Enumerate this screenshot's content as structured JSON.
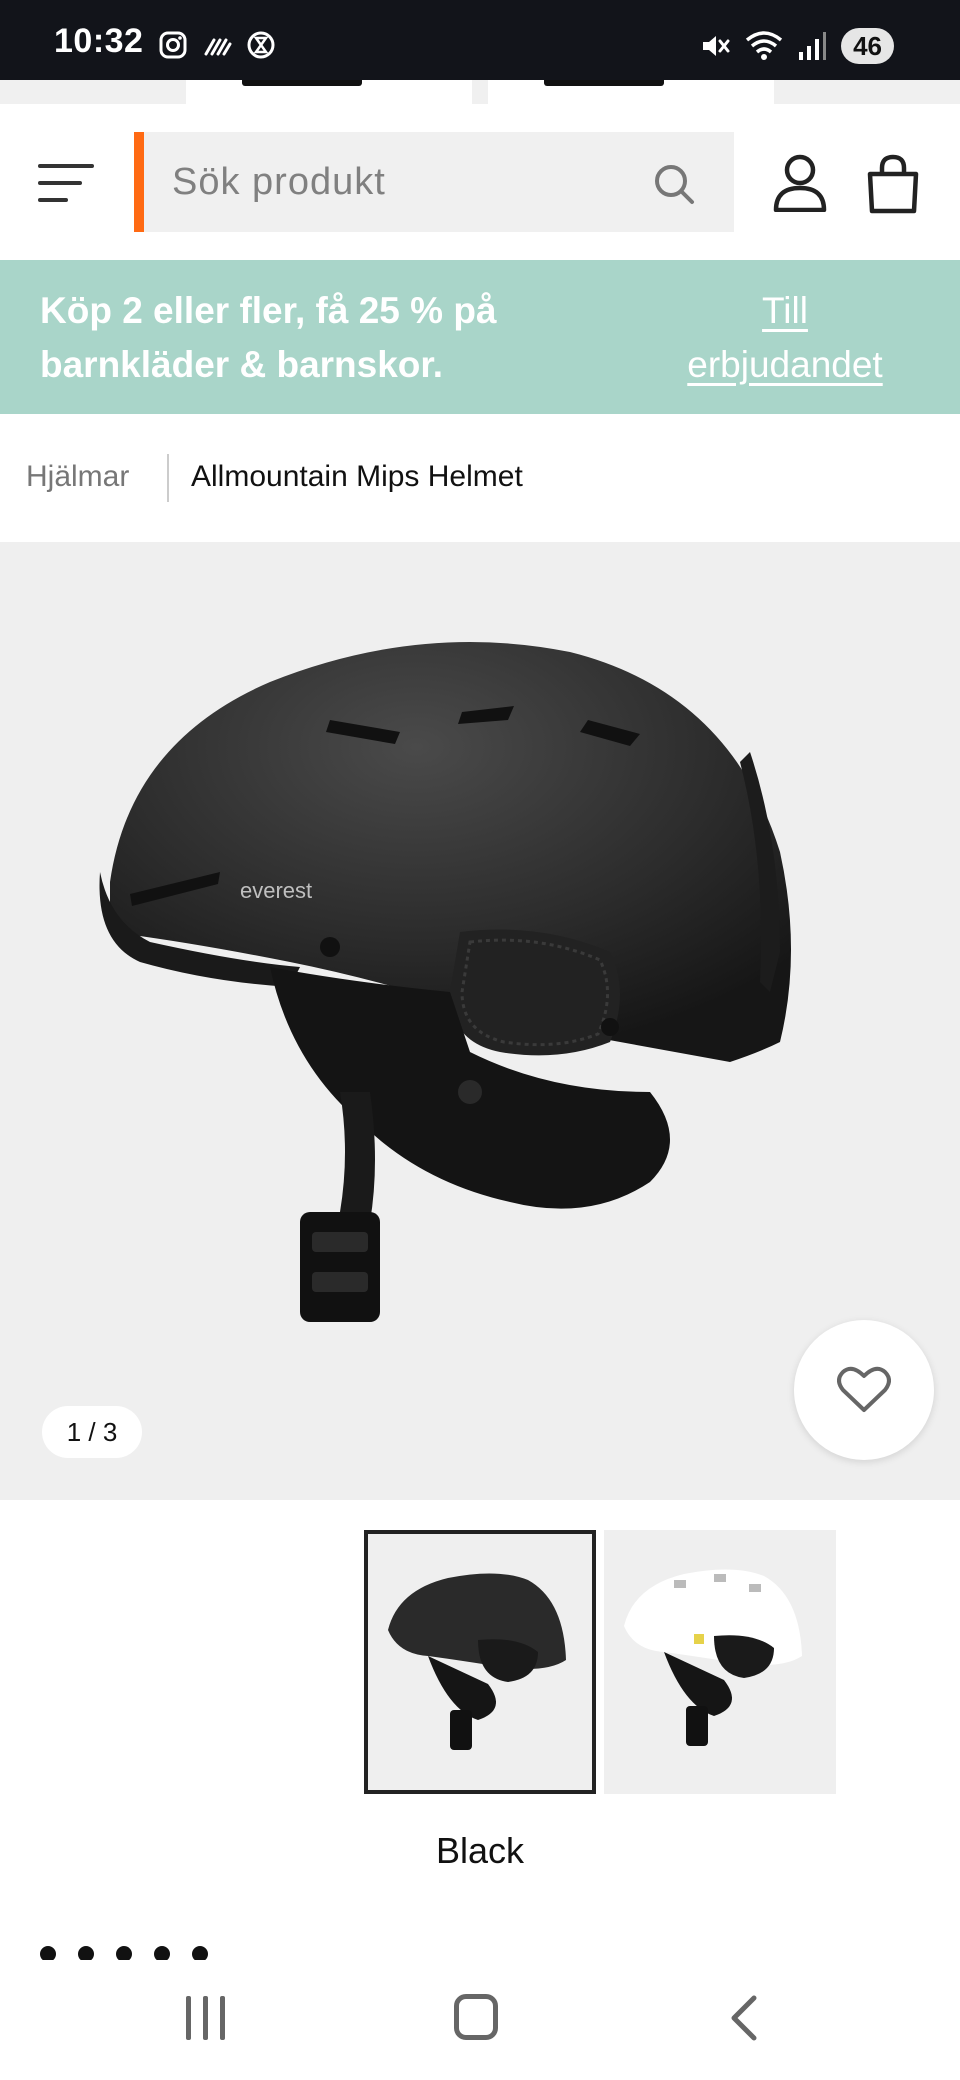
{
  "status_bar": {
    "time": "10:32",
    "battery": "46",
    "icons": [
      "instagram-icon",
      "signal-dashes-icon",
      "hourglass-icon",
      "mute-icon",
      "wifi-icon",
      "cell-signal-icon"
    ]
  },
  "header": {
    "search_placeholder": "Sök produkt",
    "accent_color": "#ff6a13",
    "icons": [
      "menu-icon",
      "search-icon",
      "user-icon",
      "bag-icon"
    ]
  },
  "promo": {
    "text": "Köp 2 eller fler, få 25 % på barnkläder & barnskor.",
    "link": "Till erbjudandet",
    "background": "#a9d5c9"
  },
  "breadcrumb": {
    "parent": "Hjälmar",
    "current": "Allmountain Mips Helmet"
  },
  "gallery": {
    "counter": "1 / 3",
    "brand_on_image": "everest",
    "wishlist_icon": "heart-icon"
  },
  "variants": {
    "selected_label": "Black",
    "items": [
      {
        "color": "black",
        "selected": true
      },
      {
        "color": "white",
        "selected": false
      }
    ]
  },
  "navbar": {
    "icons": [
      "recent-apps-icon",
      "home-icon",
      "back-icon"
    ]
  }
}
